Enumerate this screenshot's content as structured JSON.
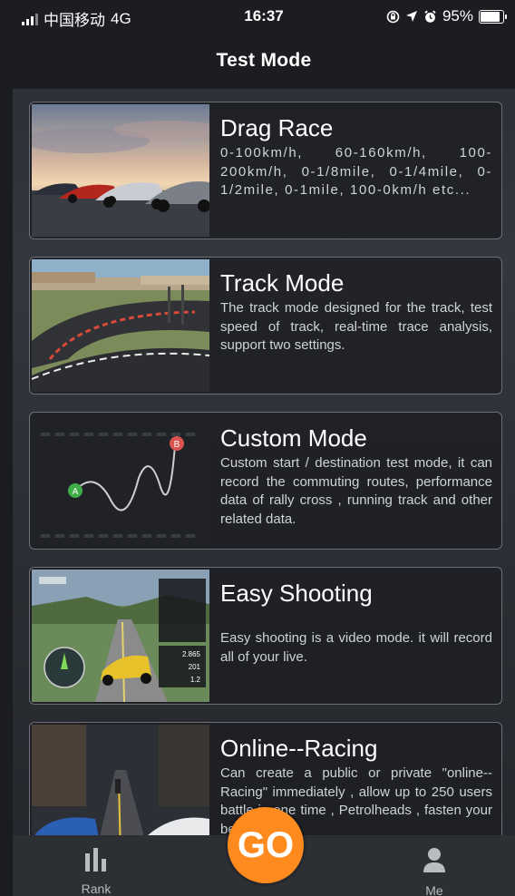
{
  "status_bar": {
    "carrier": "中国移动",
    "network": "4G",
    "time": "16:37",
    "battery": "95%",
    "battery_level": 0.95,
    "icons": [
      "signal-icon",
      "lock-rotation-icon",
      "location-icon",
      "alarm-icon",
      "battery-icon"
    ]
  },
  "nav": {
    "title": "Test Mode"
  },
  "modes": [
    {
      "title": "Drag Race",
      "description": "0-100km/h, 60-160km/h, 100-200km/h, 0-1/8mile, 0-1/4mile, 0-1/2mile, 0-1mile, 100-0km/h etc..."
    },
    {
      "title": "Track Mode",
      "description": "The track mode designed for the track, test speed of track, real-time trace analysis, support two settings."
    },
    {
      "title": "Custom Mode",
      "description": "Custom start / destination test mode, it can record the commuting routes, performance data of rally cross , running track and other related data.",
      "thumb_labels": {
        "start": "A",
        "end": "B"
      }
    },
    {
      "title": "Easy Shooting",
      "description": "Easy shooting is a video mode. it will record all of your live.",
      "thumb_readouts": [
        "2.865",
        "201",
        "1.2"
      ]
    },
    {
      "title": "Online--Racing",
      "description": "Can create a public or private \"online--Racing\" immediately , allow up to 250 users battle in one time , Petrolheads , fasten your belts and"
    }
  ],
  "tab_bar": {
    "rank_label": "Rank",
    "go_label": "GO",
    "me_label": "Me"
  },
  "colors": {
    "accent": "#ff8a1e",
    "card_border": "#6d7077",
    "background": "#2a2d33",
    "bar": "#1b1d21"
  }
}
